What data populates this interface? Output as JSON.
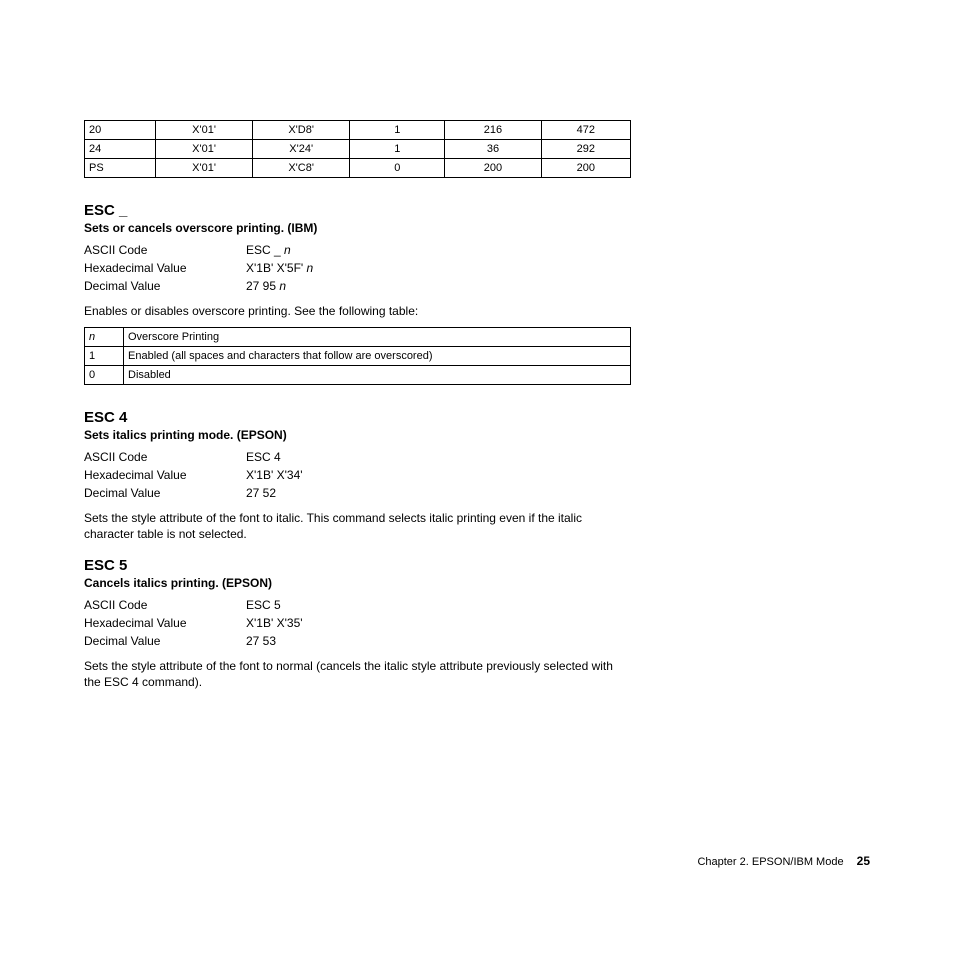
{
  "topTable": {
    "rows": [
      {
        "c1": "20",
        "c2": "X'01'",
        "c3": "X'D8'",
        "c4": "1",
        "c5": "216",
        "c6": "472"
      },
      {
        "c1": "24",
        "c2": "X'01'",
        "c3": "X'24'",
        "c4": "1",
        "c5": "36",
        "c6": "292"
      },
      {
        "c1": "PS",
        "c2": "X'01'",
        "c3": "X'C8'",
        "c4": "0",
        "c5": "200",
        "c6": "200"
      }
    ]
  },
  "escUnderscore": {
    "title": "ESC _",
    "subhead": "Sets or cancels overscore printing. (IBM)",
    "ascii_label": "ASCII Code",
    "ascii_value_prefix": "ESC _ ",
    "ascii_value_var": "n",
    "hex_label": "Hexadecimal Value",
    "hex_value_prefix": "X'1B' X'5F' ",
    "hex_value_var": "n",
    "dec_label": "Decimal Value",
    "dec_value_prefix": "27 95 ",
    "dec_value_var": "n",
    "desc": "Enables or disables overscore printing. See the following table:",
    "table": {
      "header_n": "n",
      "header_label": "Overscore Printing",
      "rows": [
        {
          "n": "1",
          "label": "Enabled (all spaces and characters that follow are overscored)"
        },
        {
          "n": "0",
          "label": "Disabled"
        }
      ]
    }
  },
  "esc4": {
    "title": "ESC 4",
    "subhead": "Sets italics printing mode. (EPSON)",
    "ascii_label": "ASCII Code",
    "ascii_value": "ESC 4",
    "hex_label": "Hexadecimal Value",
    "hex_value": "X'1B' X'34'",
    "dec_label": "Decimal Value",
    "dec_value": "27 52",
    "desc": "Sets the style attribute of the font to italic. This command selects italic printing even if the italic character table is not selected."
  },
  "esc5": {
    "title": "ESC 5",
    "subhead": "Cancels italics printing. (EPSON)",
    "ascii_label": "ASCII Code",
    "ascii_value": "ESC 5",
    "hex_label": "Hexadecimal Value",
    "hex_value": "X'1B' X'35'",
    "dec_label": "Decimal Value",
    "dec_value": "27 53",
    "desc": "Sets the style attribute of the font to normal (cancels the italic style attribute previously selected with the ESC 4 command)."
  },
  "footer": {
    "chapter": "Chapter 2. EPSON/IBM Mode",
    "page": "25"
  }
}
